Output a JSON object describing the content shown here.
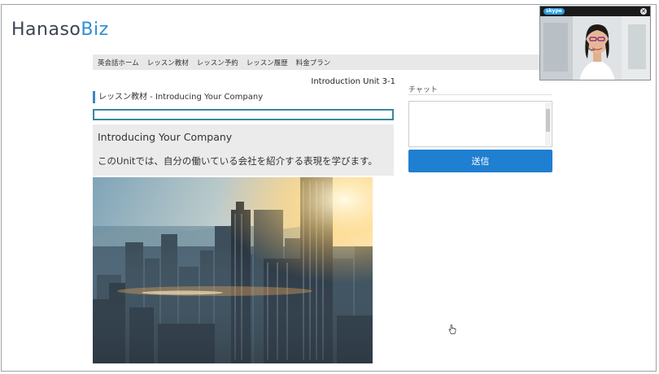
{
  "header": {
    "logo_main": "Hanaso",
    "logo_accent": "Biz"
  },
  "nav": {
    "items": [
      {
        "label": "英会話ホーム"
      },
      {
        "label": "レッスン教材"
      },
      {
        "label": "レッスン予約"
      },
      {
        "label": "レッスン履歴"
      },
      {
        "label": "料金プラン"
      }
    ]
  },
  "lesson": {
    "unit_label": "Introduction Unit 3-1",
    "material_title": "レッスン教材 - Introducing Your Company",
    "material_input_value": "",
    "heading": "Introducing Your Company",
    "description": "このUnitでは、自分の働いている会社を紹介する表現を学びます。"
  },
  "chat": {
    "label": "チャット",
    "textarea_value": "",
    "send_label": "送信"
  },
  "skype": {
    "logo_icon": "skype-logo-icon",
    "close_icon": "close-icon",
    "logo_text": "skype",
    "close_glyph": "✕"
  },
  "colors": {
    "brand_dark": "#3d4552",
    "brand_accent": "#2e8fd2",
    "send_button": "#1f7fd1",
    "nav_background": "#e8e8e8"
  }
}
